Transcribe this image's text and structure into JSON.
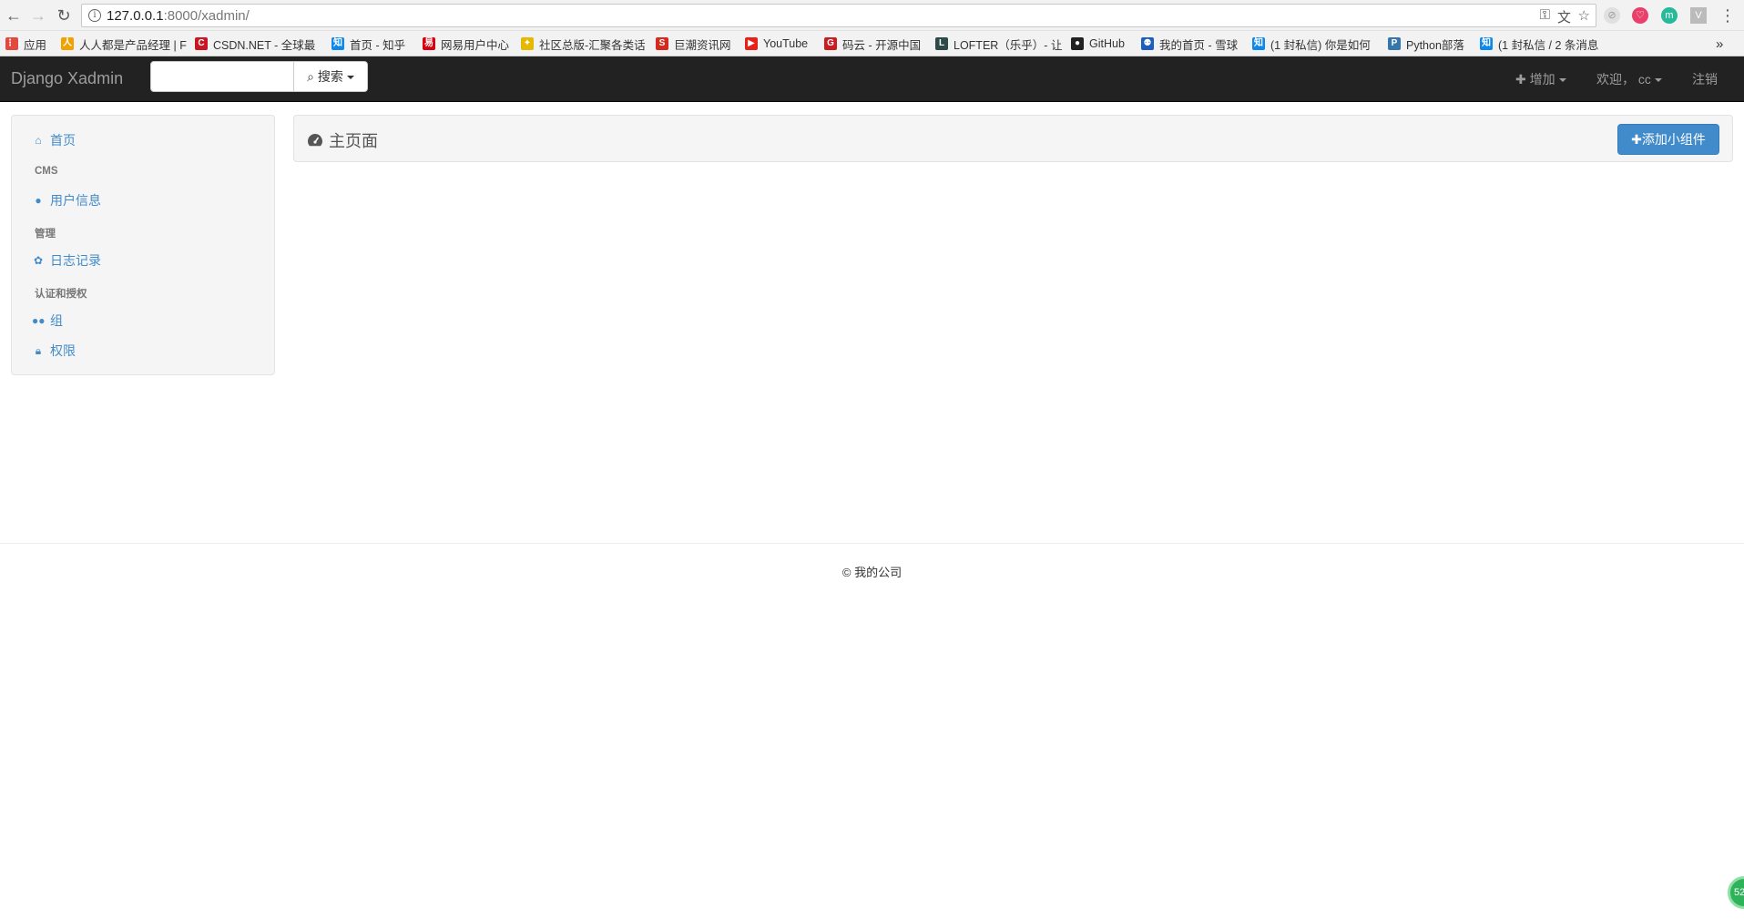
{
  "browser": {
    "url_host": "127.0.0.1",
    "url_rest": ":8000/xadmin/",
    "bookmarks": [
      {
        "label": "应用",
        "color": "#e04a3f",
        "glyph": "⋮⋮"
      },
      {
        "label": "人人都是产品经理 | F",
        "color": "#f1a100",
        "glyph": "人"
      },
      {
        "label": "CSDN.NET - 全球最",
        "color": "#c81623",
        "glyph": "C"
      },
      {
        "label": "首页 - 知乎",
        "color": "#0f88eb",
        "glyph": "知"
      },
      {
        "label": "网易用户中心",
        "color": "#d7000f",
        "glyph": "易"
      },
      {
        "label": "社区总版-汇聚各类话",
        "color": "#e6b800",
        "glyph": "✦"
      },
      {
        "label": "巨潮资讯网",
        "color": "#d42a1f",
        "glyph": "S"
      },
      {
        "label": "YouTube",
        "color": "#e62117",
        "glyph": "▶"
      },
      {
        "label": "码云 - 开源中国",
        "color": "#c71d23",
        "glyph": "G"
      },
      {
        "label": "LOFTER（乐乎）- 让",
        "color": "#2c4a48",
        "glyph": "L"
      },
      {
        "label": "GitHub",
        "color": "#222222",
        "glyph": "●"
      },
      {
        "label": "我的首页 - 雪球",
        "color": "#1d5fbf",
        "glyph": "⚉"
      },
      {
        "label": "(1 封私信) 你是如何",
        "color": "#0f88eb",
        "glyph": "知"
      },
      {
        "label": "Python部落",
        "color": "#3776ab",
        "glyph": "P"
      },
      {
        "label": "(1 封私信 / 2 条消息",
        "color": "#0f88eb",
        "glyph": "知"
      }
    ],
    "more": "»"
  },
  "navbar": {
    "brand": "Django Xadmin",
    "search_button": "搜索",
    "add_label": "增加",
    "welcome_label": "欢迎， cc",
    "logout_label": "注销"
  },
  "sidebar": {
    "home": "首页",
    "groups": [
      {
        "heading": "CMS",
        "items": [
          {
            "label": "用户信息",
            "icon": "user-icon"
          }
        ]
      },
      {
        "heading": "管理",
        "items": [
          {
            "label": "日志记录",
            "icon": "gear-icon"
          }
        ]
      },
      {
        "heading": "认证和授权",
        "items": [
          {
            "label": "组",
            "icon": "users-icon"
          },
          {
            "label": "权限",
            "icon": "lock-icon"
          }
        ]
      }
    ]
  },
  "main": {
    "title": "主页面",
    "add_widget_label": "添加小组件"
  },
  "footer": {
    "text": "© 我的公司"
  },
  "colors": {
    "navbar_bg": "#222222",
    "link": "#428bca",
    "primary_button": "#428bca"
  }
}
